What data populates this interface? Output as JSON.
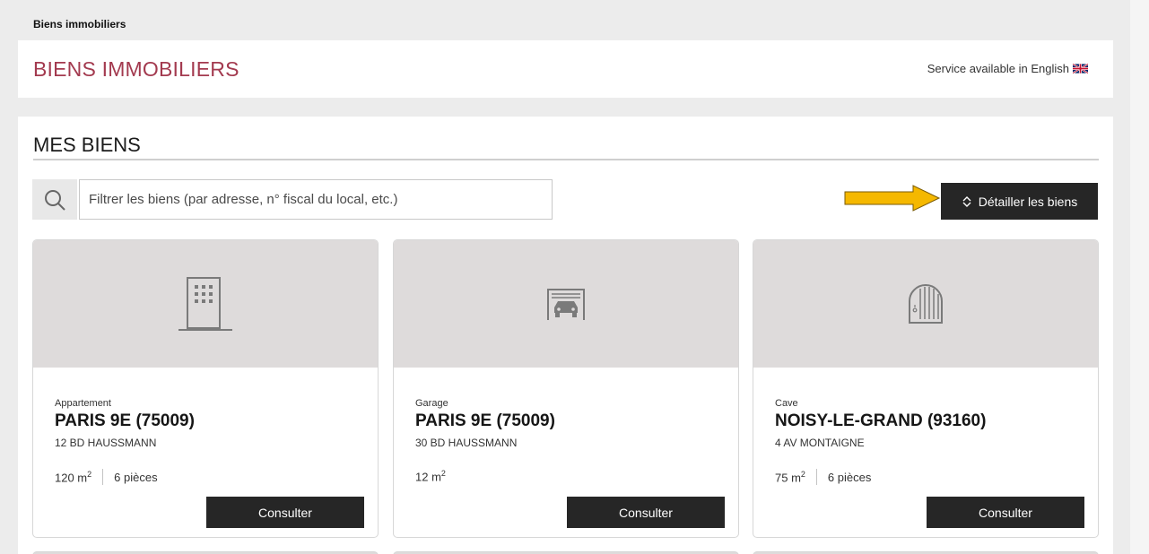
{
  "breadcrumb": "Biens immobiliers",
  "header": {
    "title": "BIENS IMMOBILIERS",
    "lang_link": "Service available in English"
  },
  "main": {
    "section_title": "MES BIENS",
    "search": {
      "placeholder": "Filtrer les biens (par adresse, n° fiscal du local, etc.)",
      "value": ""
    },
    "detail_button": "Détailler les biens",
    "cards": [
      {
        "icon": "building-icon",
        "type": "Appartement",
        "city": "PARIS 9E (75009)",
        "street": "12 BD HAUSSMANN",
        "area": "120 m",
        "area_unit_exp": "2",
        "rooms": "6 pièces",
        "action": "Consulter"
      },
      {
        "icon": "garage-icon",
        "type": "Garage",
        "city": "PARIS 9E (75009)",
        "street": "30 BD HAUSSMANN",
        "area": "12 m",
        "area_unit_exp": "2",
        "rooms": "",
        "action": "Consulter"
      },
      {
        "icon": "cellar-door-icon",
        "type": "Cave",
        "city": "NOISY-LE-GRAND (93160)",
        "street": "4 AV MONTAIGNE",
        "area": "75 m",
        "area_unit_exp": "2",
        "rooms": "6 pièces",
        "action": "Consulter"
      }
    ]
  },
  "colors": {
    "title_accent": "#a33a4f",
    "button_dark": "#262626",
    "arrow": "#f5b800",
    "image_bg": "#dedbdb"
  }
}
